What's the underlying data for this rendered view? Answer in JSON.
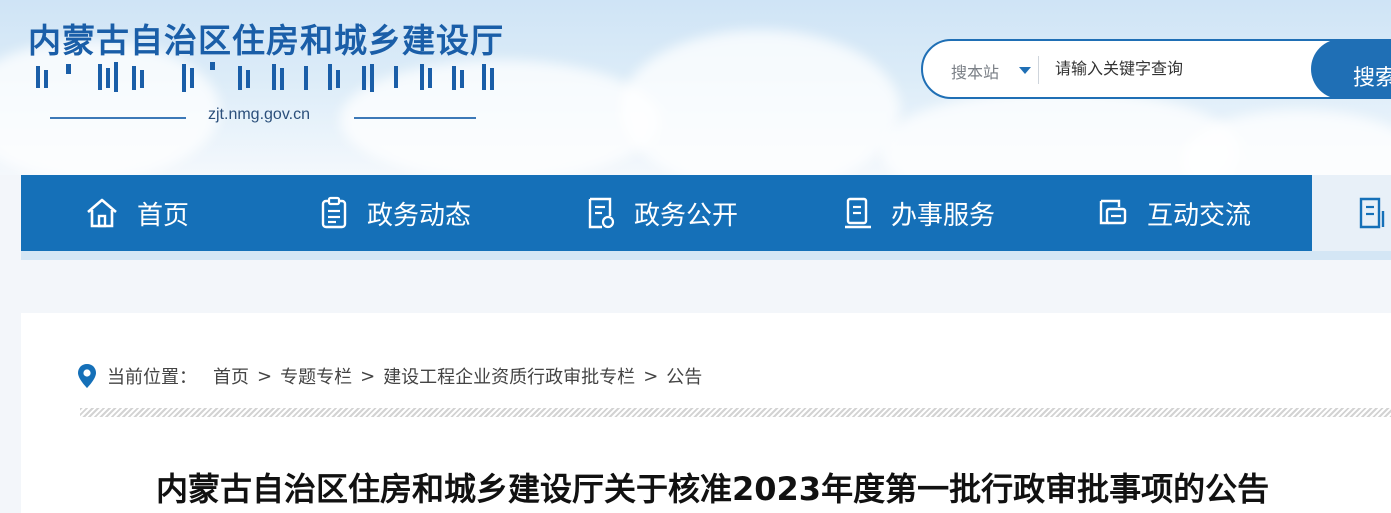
{
  "header": {
    "site_title": "内蒙古自治区住房和城乡建设厅",
    "domain": "zjt.nmg.gov.cn"
  },
  "search": {
    "scope_label": "搜本站",
    "placeholder": "请输入关键字查询",
    "button_label": "搜索"
  },
  "nav": {
    "items": [
      {
        "label": "首页",
        "icon": "home-icon"
      },
      {
        "label": "政务动态",
        "icon": "clipboard-icon"
      },
      {
        "label": "政务公开",
        "icon": "document-icon"
      },
      {
        "label": "办事服务",
        "icon": "service-icon"
      },
      {
        "label": "互动交流",
        "icon": "chat-icon"
      }
    ],
    "extra_icon": "list-icon"
  },
  "breadcrumb": {
    "prefix": "当前位置：",
    "items": [
      "首页",
      "专题专栏",
      "建设工程企业资质行政审批专栏",
      "公告"
    ],
    "separator": ">"
  },
  "article": {
    "title": "内蒙古自治区住房和城乡建设厅关于核准2023年度第一批行政审批事项的公告"
  },
  "colors": {
    "brand_blue": "#1570b8",
    "title_blue": "#1a5ea8"
  }
}
